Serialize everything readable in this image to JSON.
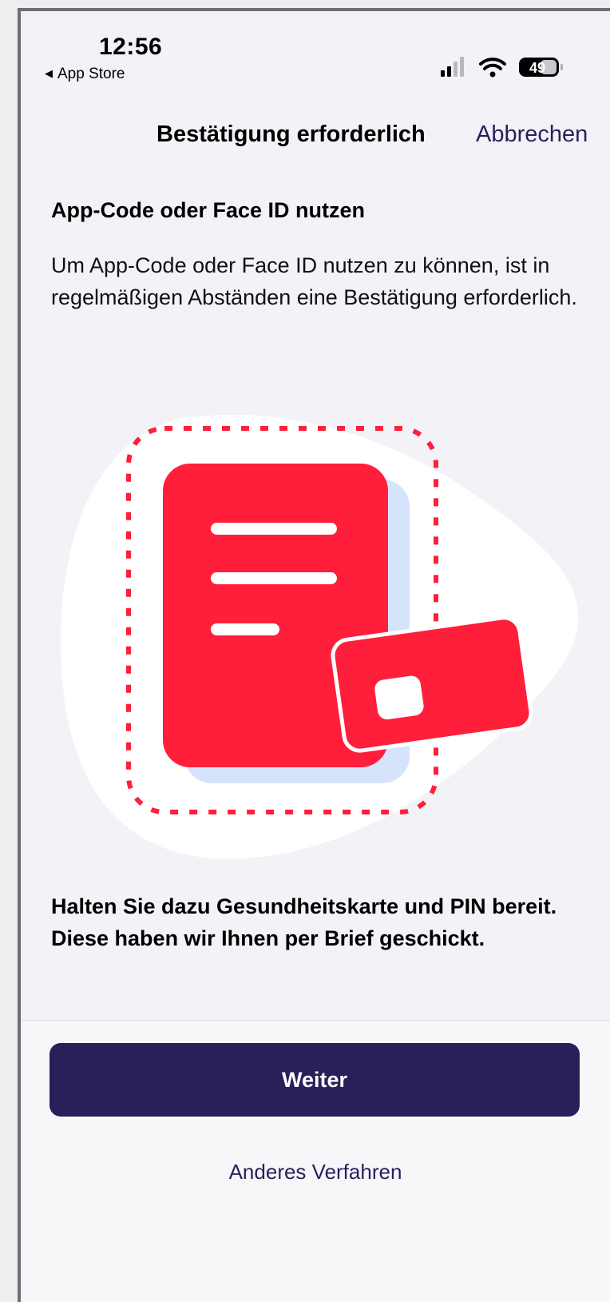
{
  "status_bar": {
    "time": "12:56",
    "back_app": "App Store",
    "battery": "49"
  },
  "nav": {
    "title": "Bestätigung erforderlich",
    "cancel": "Abbrechen"
  },
  "content": {
    "heading": "App-Code oder Face ID nutzen",
    "intro": "Um App-Code oder Face ID nutzen zu können, ist in regelmäßigen Abständen eine Bestätigung erforderlich.",
    "instruction_line1": "Halten Sie dazu Gesundheitskarte und PIN bereit.",
    "instruction_line2": "Diese haben wir Ihnen per Brief geschickt."
  },
  "actions": {
    "primary": "Weiter",
    "secondary": "Anderes Verfahren"
  },
  "colors": {
    "accent": "#29205a",
    "illustration_red": "#ff1f3a",
    "illustration_shadow": "#d6e4fb"
  },
  "icons": {
    "back": "back-triangle-icon",
    "signal": "signal-icon",
    "wifi": "wifi-icon",
    "battery": "battery-icon"
  }
}
